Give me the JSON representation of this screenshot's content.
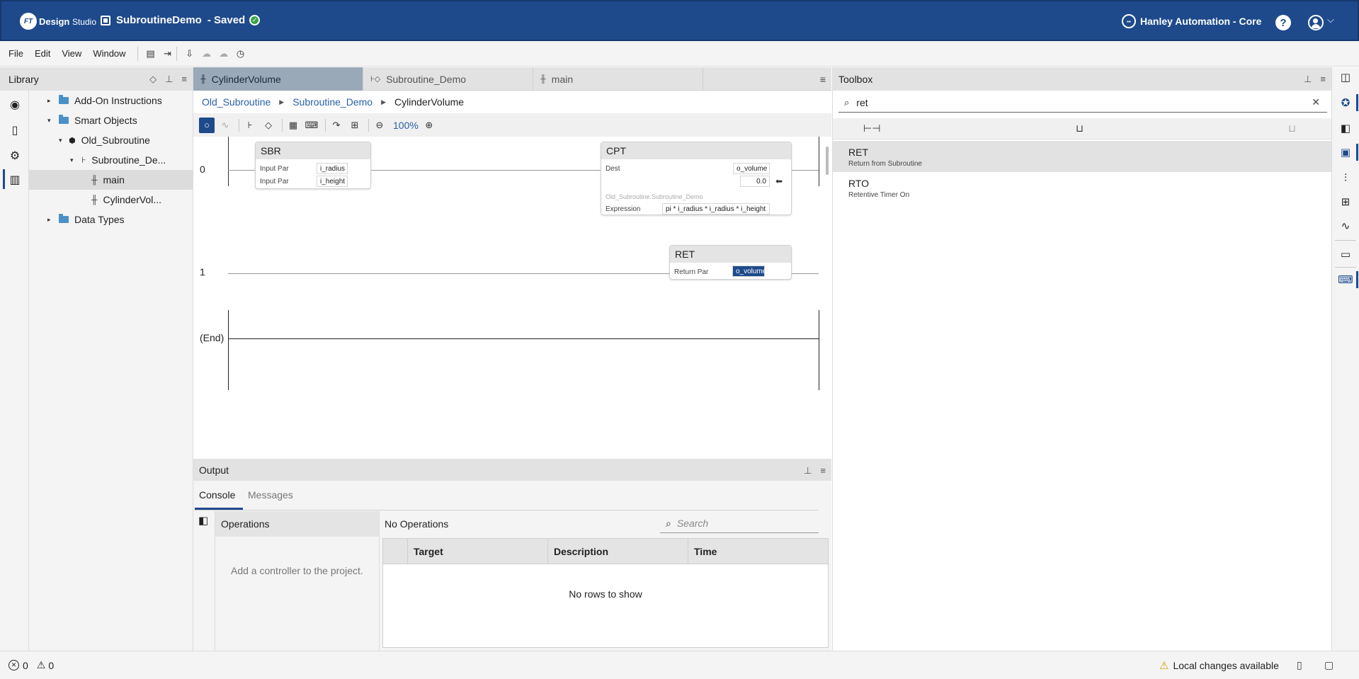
{
  "header": {
    "logo_badge": "FT",
    "logo_brand": "Design",
    "logo_product": "Studio",
    "project_name": "SubroutineDemo",
    "project_status": "- Saved",
    "org_name": "Hanley Automation - Core",
    "help": "?",
    "chevron": "⌵"
  },
  "menu": {
    "items": [
      "File",
      "Edit",
      "View",
      "Window"
    ]
  },
  "library": {
    "title": "Library",
    "tree": [
      {
        "label": "Add-On Instructions",
        "caret": "▸"
      },
      {
        "label": "Smart Objects",
        "caret": "▾"
      },
      {
        "label": "Old_Subroutine",
        "caret": "▾"
      },
      {
        "label": "Subroutine_De...",
        "caret": "▾"
      },
      {
        "label": "main"
      },
      {
        "label": "CylinderVol..."
      },
      {
        "label": "Data Types",
        "caret": "▸"
      }
    ]
  },
  "tabs": [
    {
      "label": "CylinderVolume"
    },
    {
      "label": "Subroutine_Demo"
    },
    {
      "label": "main"
    }
  ],
  "breadcrumb": {
    "items": [
      "Old_Subroutine",
      "Subroutine_Demo"
    ],
    "current": "CylinderVolume"
  },
  "editor_toolbar": {
    "zoom": "100%"
  },
  "ladder": {
    "rungs": [
      "0",
      "1",
      "(End)"
    ],
    "sbr": {
      "title": "SBR",
      "rows": [
        {
          "label": "Input Par",
          "value": "i_radius"
        },
        {
          "label": "Input Par",
          "value": "i_height"
        }
      ]
    },
    "cpt": {
      "title": "CPT",
      "dest_label": "Dest",
      "dest_value": "o_volume",
      "dest_current": "0.0",
      "path": "Old_Subroutine.Subroutine_Demo",
      "expr_label": "Expression",
      "expr_value": "pi * i_radius * i_radius * i_height"
    },
    "ret": {
      "title": "RET",
      "label": "Return Par",
      "value": "o_volume"
    }
  },
  "output": {
    "title": "Output",
    "tabs": [
      "Console",
      "Messages"
    ],
    "operations_title": "Operations",
    "operations_empty": "Add a controller to the project.",
    "no_operations": "No Operations",
    "search_placeholder": "Search",
    "columns": [
      "Target",
      "Description",
      "Time"
    ],
    "empty_rows": "No rows to show"
  },
  "toolbox": {
    "title": "Toolbox",
    "search_value": "ret",
    "items": [
      {
        "name": "RET",
        "description": "Return from Subroutine"
      },
      {
        "name": "RTO",
        "description": "Retentive Timer On"
      }
    ]
  },
  "status": {
    "errors": "0",
    "warnings": "0",
    "local_changes": "Local changes available"
  },
  "colors": {
    "brand": "#1e4a8c",
    "active_tab": "#9aa9b8",
    "link": "#2a5ea8",
    "saved": "#3ca14a",
    "warning": "#d89a00"
  }
}
